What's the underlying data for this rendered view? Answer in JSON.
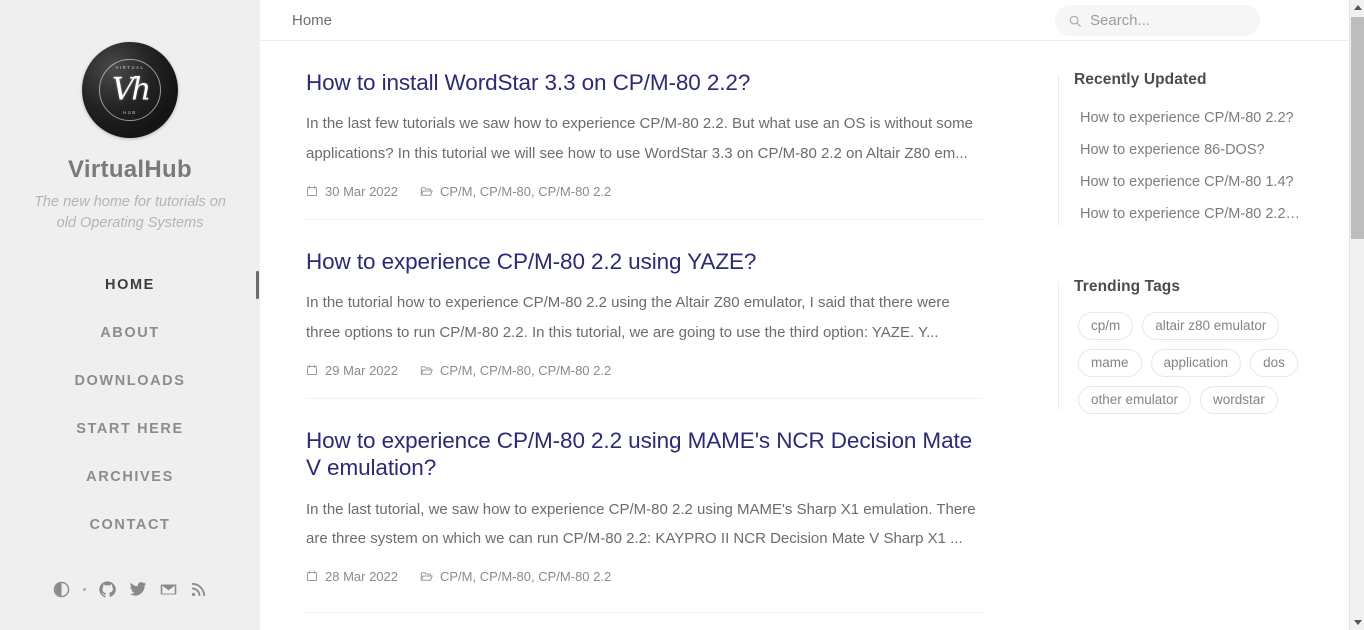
{
  "site": {
    "title": "VirtualHub",
    "tagline": "The new home for tutorials on old Operating Systems",
    "logo_monogram": "Vh",
    "logo_ring_top": "VIRTUAL",
    "logo_ring_bottom": "HUB"
  },
  "sidebar": {
    "nav": [
      {
        "label": "HOME",
        "active": true
      },
      {
        "label": "ABOUT",
        "active": false
      },
      {
        "label": "DOWNLOADS",
        "active": false
      },
      {
        "label": "START HERE",
        "active": false
      },
      {
        "label": "ARCHIVES",
        "active": false
      },
      {
        "label": "CONTACT",
        "active": false
      }
    ],
    "social": [
      {
        "name": "theme-toggle-icon"
      },
      {
        "name": "dot-separator"
      },
      {
        "name": "github-icon"
      },
      {
        "name": "twitter-icon"
      },
      {
        "name": "email-icon"
      },
      {
        "name": "rss-icon"
      }
    ]
  },
  "topbar": {
    "breadcrumb": "Home",
    "search_placeholder": "Search...",
    "search_value": ""
  },
  "posts": [
    {
      "title": "How to install WordStar 3.3 on CP/M-80 2.2?",
      "excerpt": "In the last few tutorials we saw how to experience CP/M-80 2.2. But what use an OS is without some applications? In this tutorial we will see how to use WordStar 3.3 on CP/M-80 2.2 on Altair Z80 em...",
      "date": "30 Mar 2022",
      "categories": "CP/M, CP/M-80, CP/M-80 2.2"
    },
    {
      "title": "How to experience CP/M-80 2.2 using YAZE?",
      "excerpt": "In the tutorial how to experience CP/M-80 2.2 using the Altair Z80 emulator, I said that there were three options to run CP/M-80 2.2. In this tutorial, we are going to use the third option: YAZE. Y...",
      "date": "29 Mar 2022",
      "categories": "CP/M, CP/M-80, CP/M-80 2.2"
    },
    {
      "title": "How to experience CP/M-80 2.2 using MAME's NCR Decision Mate V emulation?",
      "excerpt": "In the last tutorial, we saw how to experience CP/M-80 2.2 using MAME's Sharp X1 emulation. There are three system on which we can run CP/M-80 2.2: KAYPRO II NCR Decision Mate V Sharp X1 ...",
      "date": "28 Mar 2022",
      "categories": "CP/M, CP/M-80, CP/M-80 2.2"
    }
  ],
  "aside": {
    "recently_updated": {
      "title": "Recently Updated",
      "items": [
        "How to experience CP/M-80 2.2?",
        "How to experience 86-DOS?",
        "How to experience CP/M-80 1.4?",
        "How to experience CP/M-80 2.2…"
      ]
    },
    "trending_tags": {
      "title": "Trending Tags",
      "tags": [
        "cp/m",
        "altair z80 emulator",
        "mame",
        "application",
        "dos",
        "other emulator",
        "wordstar"
      ]
    }
  },
  "colors": {
    "sidebar_bg": "#efefef",
    "link": "#2a2a78",
    "muted_text": "#6c6c70",
    "accent_bar": "#6b6b6b"
  }
}
